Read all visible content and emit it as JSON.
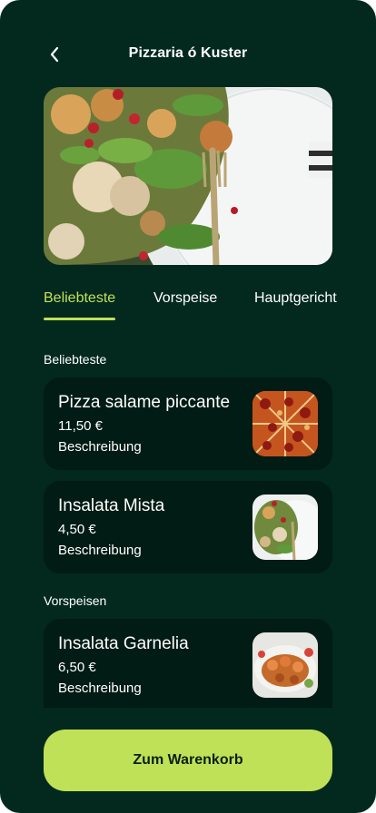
{
  "header": {
    "title": "Pizzaria ó Kuster",
    "back_icon": "chevron-left-icon"
  },
  "hero": {
    "image": "salad-plate-with-fork"
  },
  "tabs": [
    {
      "label": "Beliebteste",
      "active": true
    },
    {
      "label": "Vorspeise",
      "active": false
    },
    {
      "label": "Hauptgericht",
      "active": false
    }
  ],
  "sections": [
    {
      "label": "Beliebteste",
      "items": [
        {
          "name": "Pizza salame piccante",
          "price": "11,50 €",
          "description": "Beschreibung",
          "image": "pizza"
        },
        {
          "name": "Insalata Mista",
          "price": "4,50 €",
          "description": "Beschreibung",
          "image": "mixed-salad"
        }
      ]
    },
    {
      "label": "Vorspeisen",
      "items": [
        {
          "name": "Insalata Garnelia",
          "price": "6,50 €",
          "description": "Beschreibung",
          "image": "shrimp-platter"
        }
      ]
    }
  ],
  "cart_button": {
    "label": "Zum Warenkorb"
  },
  "colors": {
    "background": "#03291f",
    "card": "#011c14",
    "accent": "#bfe157"
  }
}
